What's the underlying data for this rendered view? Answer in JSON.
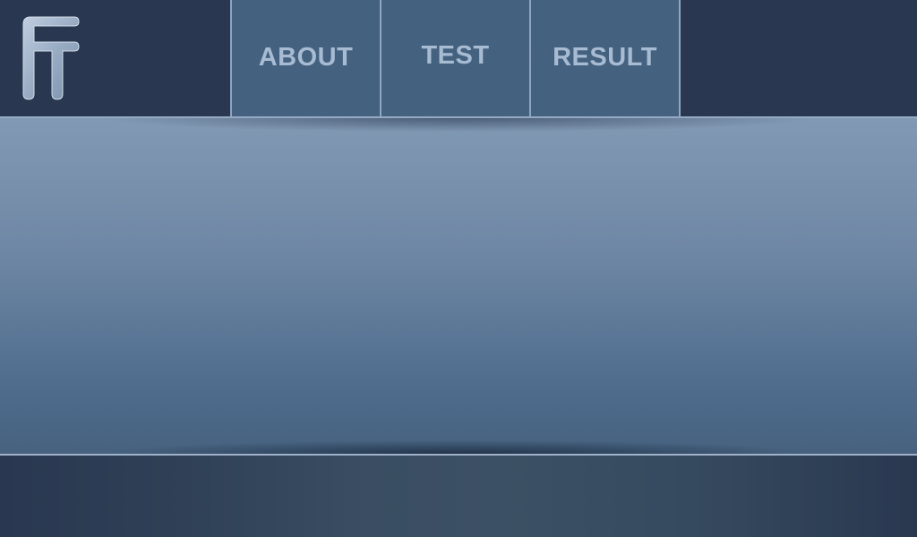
{
  "app": {
    "logo_icon": "ft-logo-icon"
  },
  "nav": {
    "tabs": [
      {
        "label": "ABOUT"
      },
      {
        "label": "TEST"
      },
      {
        "label": "RESULT"
      }
    ]
  },
  "colors": {
    "header_bg": "#293850",
    "tab_bg": "#44617f",
    "tab_text": "#a7bbd3",
    "tab_border": "#8ea6c4",
    "content_top": "#8299b4",
    "content_bottom": "#46627f"
  }
}
